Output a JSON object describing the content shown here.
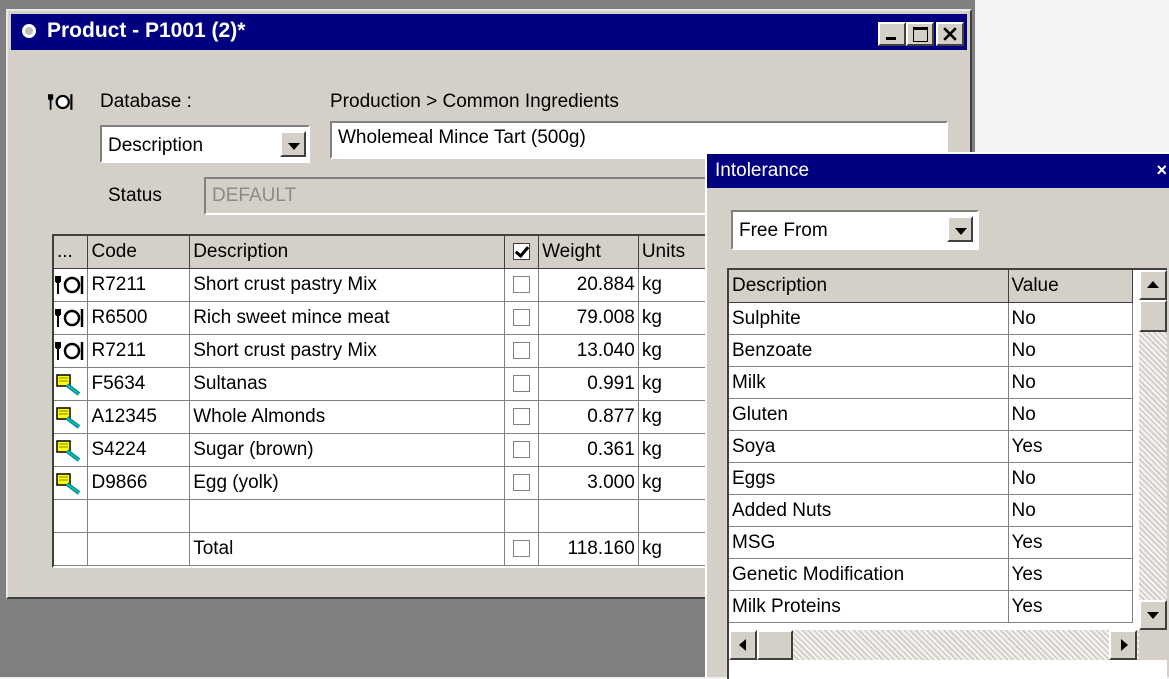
{
  "product_window": {
    "title": "Product - P1001 (2)*",
    "database_label": "Database :",
    "database_path": "Production > Common Ingredients",
    "field_select": "Description",
    "name_value": "Wholemeal Mince Tart (500g)",
    "status_label": "Status",
    "status_value": "DEFAULT",
    "grid": {
      "columns": [
        "...",
        "Code",
        "Description",
        "",
        "Weight",
        "Units"
      ],
      "rows": [
        {
          "icon": "cutlery-icon",
          "code": "R7211",
          "description": "Short crust pastry Mix",
          "checked": false,
          "weight": "20.884",
          "units": "kg"
        },
        {
          "icon": "cutlery-icon",
          "code": "R6500",
          "description": "Rich sweet mince meat",
          "checked": false,
          "weight": "79.008",
          "units": "kg"
        },
        {
          "icon": "cutlery-icon",
          "code": "R7211",
          "description": "Short crust pastry Mix",
          "checked": false,
          "weight": "13.040",
          "units": "kg"
        },
        {
          "icon": "ingredient-search-icon",
          "code": "F5634",
          "description": "Sultanas",
          "checked": false,
          "weight": "0.991",
          "units": "kg"
        },
        {
          "icon": "ingredient-search-icon",
          "code": "A12345",
          "description": "Whole Almonds",
          "checked": false,
          "weight": "0.877",
          "units": "kg"
        },
        {
          "icon": "ingredient-search-icon",
          "code": "S4224",
          "description": "Sugar (brown)",
          "checked": false,
          "weight": "0.361",
          "units": "kg"
        },
        {
          "icon": "ingredient-search-icon",
          "code": "D9866",
          "description": "Egg (yolk)",
          "checked": false,
          "weight": "3.000",
          "units": "kg"
        }
      ],
      "total": {
        "label": "Total",
        "weight": "118.160",
        "units": "kg"
      }
    }
  },
  "intolerance_window": {
    "title": "Intolerance",
    "close": "×",
    "filter": "Free From",
    "columns": [
      "Description",
      "Value"
    ],
    "rows": [
      {
        "description": "Sulphite",
        "value": "No"
      },
      {
        "description": "Benzoate",
        "value": "No"
      },
      {
        "description": "Milk",
        "value": "No"
      },
      {
        "description": "Gluten",
        "value": "No"
      },
      {
        "description": "Soya",
        "value": "Yes"
      },
      {
        "description": "Eggs",
        "value": "No"
      },
      {
        "description": "Added Nuts",
        "value": "No"
      },
      {
        "description": "MSG",
        "value": "Yes"
      },
      {
        "description": "Genetic Modification",
        "value": "Yes"
      },
      {
        "description": "Milk Proteins",
        "value": "Yes"
      }
    ]
  }
}
